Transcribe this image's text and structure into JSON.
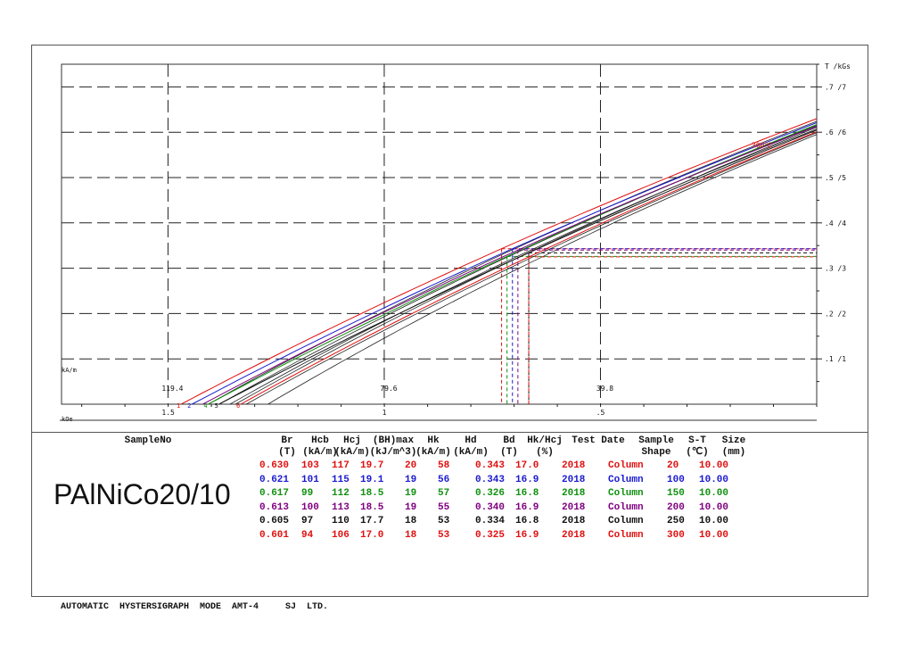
{
  "chart_data": {
    "type": "line",
    "title": "",
    "y_unit_label": "T /kGs",
    "x_unit_label_upper": "kA/m",
    "x_unit_label_lower": "kOe",
    "y_ticks": [
      {
        "value": 0.1,
        "label": ".1 /1"
      },
      {
        "value": 0.2,
        "label": ".2 /2"
      },
      {
        "value": 0.3,
        "label": ".3 /3"
      },
      {
        "value": 0.4,
        "label": ".4 /4"
      },
      {
        "value": 0.5,
        "label": ".5 /5"
      },
      {
        "value": 0.6,
        "label": ".6 /6"
      },
      {
        "value": 0.7,
        "label": ".7 /7"
      }
    ],
    "x_ticks_kAm": [
      {
        "value": 119.4,
        "label": "119.4"
      },
      {
        "value": 79.6,
        "label": "79.6"
      },
      {
        "value": 39.8,
        "label": "39.8"
      }
    ],
    "x_ticks_kOe": [
      {
        "value": 1.5,
        "label": "1.5"
      },
      {
        "value": 1.0,
        "label": "1"
      },
      {
        "value": 0.5,
        "label": ".5"
      }
    ],
    "ylim": [
      0,
      0.75
    ],
    "xlim_kAm": [
      139,
      0
    ],
    "grid": true,
    "curve_labels": [
      "1",
      "2",
      "4",
      "5",
      "6"
    ],
    "annotation": "300℃",
    "series": [
      {
        "name": "20",
        "color": "#e01010",
        "Br": 0.63,
        "Hcj": 117,
        "Hd": 58,
        "Bd": 0.343
      },
      {
        "name": "100",
        "color": "#1a1ad0",
        "Br": 0.621,
        "Hcj": 115,
        "Hd": 56,
        "Bd": 0.343
      },
      {
        "name": "150",
        "color": "#109010",
        "Br": 0.617,
        "Hcj": 112,
        "Hd": 57,
        "Bd": 0.326
      },
      {
        "name": "200",
        "color": "#800080",
        "Br": 0.613,
        "Hcj": 113,
        "Hd": 55,
        "Bd": 0.34
      },
      {
        "name": "250",
        "color": "#111111",
        "Br": 0.605,
        "Hcj": 110,
        "Hd": 53,
        "Bd": 0.334
      },
      {
        "name": "300",
        "color": "#e01010",
        "Br": 0.601,
        "Hcj": 106,
        "Hd": 53,
        "Bd": 0.325
      }
    ]
  },
  "table": {
    "headers": [
      {
        "key": "sampleno",
        "label": "SampleNo"
      },
      {
        "key": "br",
        "label": "Br\n(T)"
      },
      {
        "key": "hcb",
        "label": "Hcb\n(kA/m)"
      },
      {
        "key": "hcj",
        "label": "Hcj\n(kA/m)"
      },
      {
        "key": "bhmax",
        "label": "(BH)max\n(kJ/m^3)"
      },
      {
        "key": "hk",
        "label": "Hk\n(kA/m)"
      },
      {
        "key": "hd",
        "label": "Hd\n(kA/m)"
      },
      {
        "key": "bd",
        "label": "Bd\n(T)"
      },
      {
        "key": "hkhcj",
        "label": "Hk/Hcj\n(%)"
      },
      {
        "key": "date",
        "label": "Test Date"
      },
      {
        "key": "shape",
        "label": "Sample\nShape"
      },
      {
        "key": "st",
        "label": "S-T\n(℃)"
      },
      {
        "key": "size",
        "label": "Size\n(mm)"
      }
    ],
    "rows": [
      {
        "color": "#e01010",
        "cells": [
          "0.630",
          "103",
          "117",
          "19.7",
          "20",
          "58",
          "0.343",
          "17.0",
          "2018",
          "Column",
          "20",
          "10.00"
        ]
      },
      {
        "color": "#1a1ad0",
        "cells": [
          "0.621",
          "101",
          "115",
          "19.1",
          "19",
          "56",
          "0.343",
          "16.9",
          "2018",
          "Column",
          "100",
          "10.00"
        ]
      },
      {
        "color": "#109010",
        "cells": [
          "0.617",
          "99",
          "112",
          "18.5",
          "19",
          "57",
          "0.326",
          "16.8",
          "2018",
          "Column",
          "150",
          "10.00"
        ]
      },
      {
        "color": "#800080",
        "cells": [
          "0.613",
          "100",
          "113",
          "18.5",
          "19",
          "55",
          "0.340",
          "16.9",
          "2018",
          "Column",
          "200",
          "10.00"
        ]
      },
      {
        "color": "#111111",
        "cells": [
          "0.605",
          "97",
          "110",
          "17.7",
          "18",
          "53",
          "0.334",
          "16.8",
          "2018",
          "Column",
          "250",
          "10.00"
        ]
      },
      {
        "color": "#e01010",
        "cells": [
          "0.601",
          "94",
          "106",
          "17.0",
          "18",
          "53",
          "0.325",
          "16.9",
          "2018",
          "Column",
          "300",
          "10.00"
        ]
      }
    ]
  },
  "sample_name": "PAlNiCo20/10",
  "footer": "AUTOMATIC  HYSTERSIGRAPH  MODE  AMT-4     SJ  LTD."
}
